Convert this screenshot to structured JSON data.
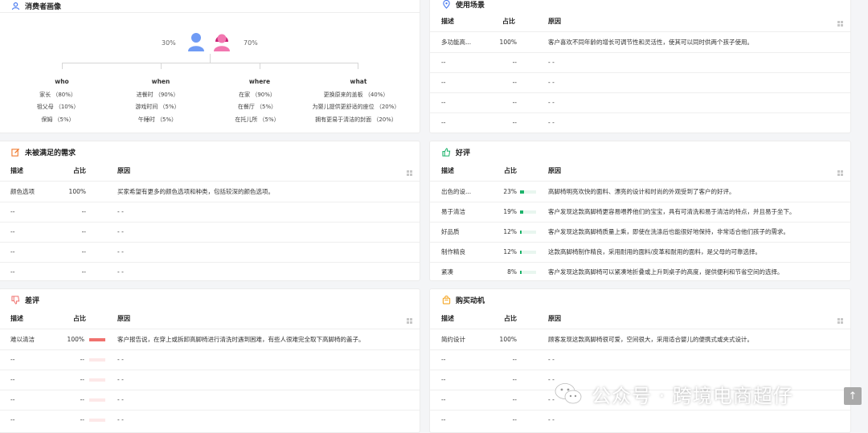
{
  "persona": {
    "title": "消费者画像",
    "male_pct": "30%",
    "female_pct": "70%",
    "columns": [
      {
        "head": "who",
        "items": [
          "家长 （80%）",
          "祖父母 （10%）",
          "保姆 （5%）"
        ]
      },
      {
        "head": "when",
        "items": [
          "进餐时 （90%）",
          "游戏时间 （5%）",
          "午睡时 （5%）"
        ]
      },
      {
        "head": "where",
        "items": [
          "在家 （90%）",
          "在餐厅 （5%）",
          "在托儿所 （5%）"
        ]
      },
      {
        "head": "what",
        "items": [
          "更换原来的盖板 （40%）",
          "为婴儿提供更舒适的座位 （20%）",
          "拥有更易于清洁的封面 （20%）"
        ]
      }
    ]
  },
  "usage": {
    "title": "使用场景",
    "headers": {
      "desc": "描述",
      "pct": "占比",
      "reason": "原因"
    },
    "rows": [
      {
        "desc": "多功能高...",
        "pct": "100%",
        "reason": "客户喜欢不同年龄的增长可调节性和灵活性，使其可以同时供两个孩子使用。"
      },
      {
        "desc": "--",
        "pct": "--",
        "reason": "- -"
      },
      {
        "desc": "--",
        "pct": "--",
        "reason": "- -"
      },
      {
        "desc": "--",
        "pct": "--",
        "reason": "- -"
      },
      {
        "desc": "--",
        "pct": "--",
        "reason": "- -"
      }
    ]
  },
  "unmet": {
    "title": "未被满足的需求",
    "headers": {
      "desc": "描述",
      "pct": "占比",
      "reason": "原因"
    },
    "rows": [
      {
        "desc": "颜色选项",
        "pct": "100%",
        "reason": "买家希望有更多的颜色选项和种类，包括较深的颜色选项。"
      },
      {
        "desc": "--",
        "pct": "--",
        "reason": "- -"
      },
      {
        "desc": "--",
        "pct": "--",
        "reason": "- -"
      },
      {
        "desc": "--",
        "pct": "--",
        "reason": "- -"
      },
      {
        "desc": "--",
        "pct": "--",
        "reason": "- -"
      }
    ]
  },
  "good": {
    "title": "好评",
    "headers": {
      "desc": "描述",
      "pct": "占比",
      "reason": "原因"
    },
    "rows": [
      {
        "desc": "出色的设...",
        "pct": "23%",
        "fill": 0.23,
        "reason": "高脚椅明亮欢快的面料、漂亮的设计和时尚的外观受到了客户的好评。"
      },
      {
        "desc": "易于清洁",
        "pct": "19%",
        "fill": 0.19,
        "reason": "客户发现这款高脚椅更容易喂养他们的宝宝，具有可清洗和易于清洁的特点，并且易于坐下。"
      },
      {
        "desc": "好品质",
        "pct": "12%",
        "fill": 0.12,
        "reason": "客户发现这款高脚椅质量上乘，即使在洗涤后也能很好地保持，非常适合他们孩子的需求。"
      },
      {
        "desc": "制作精良",
        "pct": "12%",
        "fill": 0.12,
        "reason": "这款高脚椅制作精良，采用耐用的面料/皮革和耐用的面料，是父母的可靠选择。"
      },
      {
        "desc": "紧凑",
        "pct": "8%",
        "fill": 0.08,
        "reason": "客户发现这款高脚椅可以紧凑地折叠或上升到桌子的高度，提供便利和节省空间的选择。"
      }
    ]
  },
  "bad": {
    "title": "差评",
    "headers": {
      "desc": "描述",
      "pct": "占比",
      "reason": "原因"
    },
    "rows": [
      {
        "desc": "难以清洁",
        "pct": "100%",
        "fill": 1.0,
        "reason": "客户报告说，在穿上或拆卸高脚椅进行清洗时遇到困难，有些人很难完全取下高脚椅的盖子。"
      },
      {
        "desc": "--",
        "pct": "--",
        "fill": 0,
        "reason": "- -"
      },
      {
        "desc": "--",
        "pct": "--",
        "fill": 0,
        "reason": "- -"
      },
      {
        "desc": "--",
        "pct": "--",
        "fill": 0,
        "reason": "- -"
      },
      {
        "desc": "--",
        "pct": "--",
        "fill": 0,
        "reason": "- -"
      }
    ]
  },
  "motive": {
    "title": "购买动机",
    "headers": {
      "desc": "描述",
      "pct": "占比",
      "reason": "原因"
    },
    "rows": [
      {
        "desc": "简约设计",
        "pct": "100%",
        "reason": "顾客发现这款高脚椅很可爱，空间很大，采用适合婴儿的便携式或夹式设计。"
      },
      {
        "desc": "--",
        "pct": "--",
        "reason": "- -"
      },
      {
        "desc": "--",
        "pct": "--",
        "reason": "- -"
      },
      {
        "desc": "--",
        "pct": "--",
        "reason": "- -"
      },
      {
        "desc": "--",
        "pct": "--",
        "reason": "- -"
      }
    ]
  },
  "watermark": {
    "text": "公众号 · 跨境电商超仔",
    "icon": "wechat-icon"
  },
  "back_to_top": "↑",
  "colors": {
    "good_bar": "#1bb36a",
    "bad_bar": "#f0716e",
    "usage_icon": "#4a7bf0",
    "unmet_icon": "#f07a2e",
    "good_icon": "#1bb36a",
    "bad_icon": "#f0716e",
    "motive_icon": "#f5a623"
  }
}
